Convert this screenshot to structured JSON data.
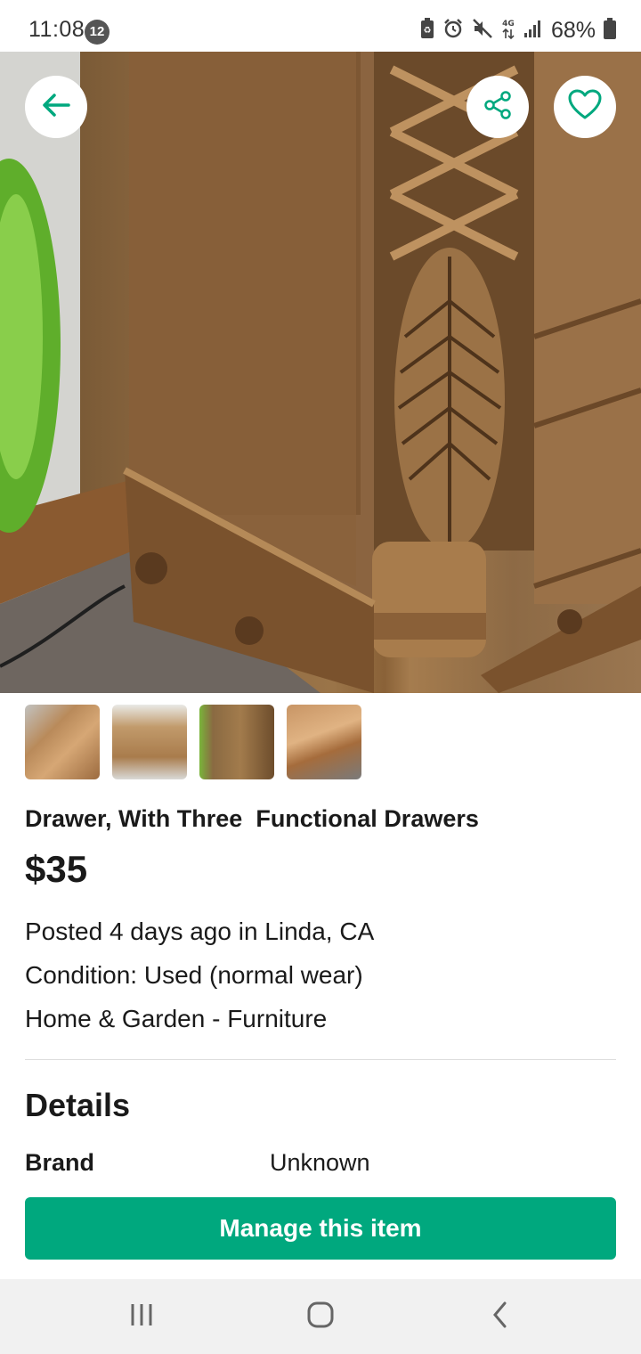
{
  "status_bar": {
    "time": "11:08",
    "notification_count": "12",
    "network_label": "4G",
    "battery_percent": "68%",
    "icons": [
      "battery-saver-icon",
      "alarm-icon",
      "mute-icon",
      "network-4g-icon",
      "signal-icon",
      "battery-icon"
    ]
  },
  "hero": {
    "photo_subject": "carved wooden dresser corner",
    "back_icon": "arrow-left-icon",
    "share_icon": "share-icon",
    "favorite_icon": "heart-icon"
  },
  "thumbnails": [
    {
      "subject": "wood tabletop"
    },
    {
      "subject": "nightstand with drawers"
    },
    {
      "subject": "carved dresser corner"
    },
    {
      "subject": "wood surface close-up"
    }
  ],
  "listing": {
    "title": "Drawer, With Three  Functional Drawers",
    "price": "$35",
    "posted": "Posted 4 days ago in Linda, CA",
    "condition": "Condition: Used (normal wear)",
    "category": "Home & Garden - Furniture"
  },
  "details": {
    "heading": "Details",
    "rows": [
      {
        "key": "Brand",
        "value": "Unknown"
      }
    ]
  },
  "actions": {
    "manage_label": "Manage this item"
  },
  "colors": {
    "accent": "#00a87e",
    "text": "#1a1a1a",
    "nav_bar": "#f1f1f1"
  }
}
